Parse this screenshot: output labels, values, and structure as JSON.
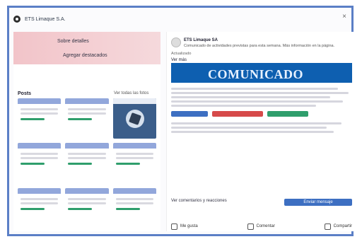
{
  "header": {
    "page_name": "ETS Limaque S.A.",
    "close_symbol": "×"
  },
  "left": {
    "links": [
      "Sobre detalles",
      "Agregar destacados"
    ],
    "posts_title": "Posts",
    "posts_see_all": "Ver todas las fotos"
  },
  "right": {
    "post_author": "ETS Limaque SA",
    "post_meta": "Comunicado de actividades previstas para esta semana. Más información en la página.",
    "post_time": "Actualizado",
    "see_more": "Ver más",
    "banner_title": "COMUNICADO",
    "footer_link": "Ver comentarios y reacciones",
    "cta_label": "Enviar mensaje",
    "actions": {
      "like": "Me gusta",
      "comment": "Comentar",
      "share": "Compartir"
    }
  },
  "colors": {
    "frame": "#5b7fc6",
    "hero_pink": "#f2c4c9",
    "banner_blue": "#0e5fb0",
    "accent_blue": "#3d6fc2",
    "green": "#2f9e6c"
  }
}
